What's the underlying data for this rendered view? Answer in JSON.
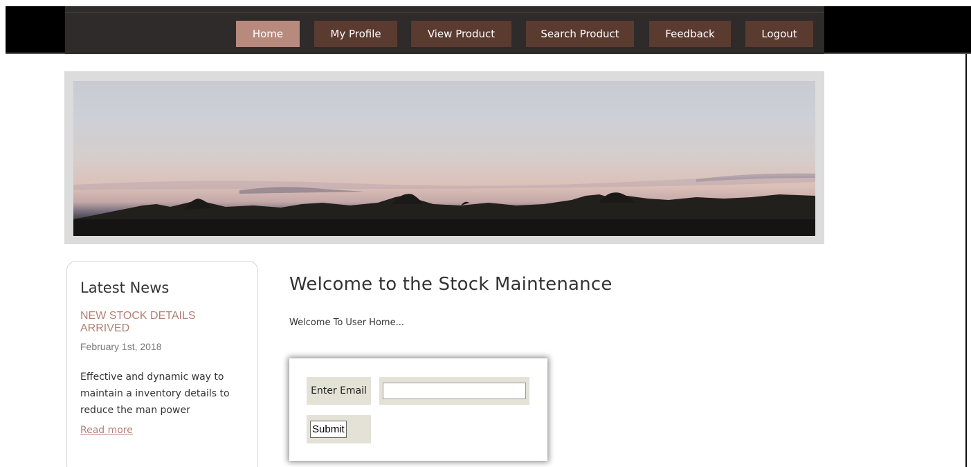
{
  "nav": {
    "items": [
      {
        "label": "Home",
        "active": true
      },
      {
        "label": "My Profile",
        "active": false
      },
      {
        "label": "View Product",
        "active": false
      },
      {
        "label": "Search Product",
        "active": false
      },
      {
        "label": "Feedback",
        "active": false
      },
      {
        "label": "Logout",
        "active": false
      }
    ]
  },
  "sidebar": {
    "title": "Latest News",
    "news_title": "NEW STOCK DETAILS ARRIVED",
    "news_date": "February 1st, 2018",
    "news_body": "Effective and dynamic way to maintain a inventory details to reduce the man power",
    "read_more": "Read more"
  },
  "main": {
    "title": "Welcome to the Stock Maintenance",
    "subtitle": "Welcome To User Home...",
    "form": {
      "email_label": "Enter Email",
      "email_value": "",
      "submit_label": "Submit"
    }
  },
  "colors": {
    "nav_bg": "#5b3a30",
    "nav_active": "#b88a7d",
    "accent_text": "#b07f72",
    "form_cell": "#e4e2d6"
  }
}
